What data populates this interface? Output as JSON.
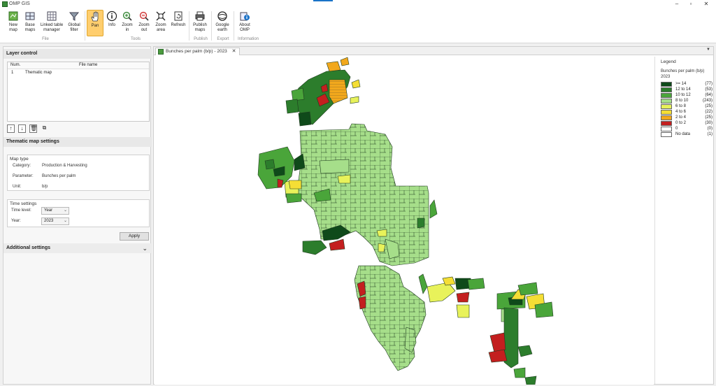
{
  "window": {
    "title": "OMP GIS",
    "controls": [
      "–",
      "▫",
      "✕"
    ]
  },
  "ribbon": {
    "buttons": [
      {
        "key": "new_map",
        "line1": "New",
        "line2": "map",
        "icon": "new-map-icon"
      },
      {
        "key": "base_maps",
        "line1": "Base",
        "line2": "maps",
        "icon": "base-maps-icon"
      },
      {
        "key": "linked_table",
        "line1": "Linked table",
        "line2": "manager",
        "icon": "table-icon"
      },
      {
        "key": "global_filter",
        "line1": "Global",
        "line2": "filter",
        "icon": "filter-icon"
      },
      {
        "key": "pan",
        "line1": "Pan",
        "line2": "",
        "icon": "hand-icon"
      },
      {
        "key": "info",
        "line1": "Info",
        "line2": "",
        "icon": "info-icon"
      },
      {
        "key": "zoom_in",
        "line1": "Zoom",
        "line2": "in",
        "icon": "zoom-in-icon"
      },
      {
        "key": "zoom_out",
        "line1": "Zoom",
        "line2": "out",
        "icon": "zoom-out-icon"
      },
      {
        "key": "zoom_area",
        "line1": "Zoom",
        "line2": "area",
        "icon": "zoom-area-icon"
      },
      {
        "key": "refresh",
        "line1": "Refresh",
        "line2": "",
        "icon": "refresh-icon"
      },
      {
        "key": "publish_maps",
        "line1": "Publish",
        "line2": "maps",
        "icon": "printer-icon"
      },
      {
        "key": "google_earth",
        "line1": "Google",
        "line2": "earth",
        "icon": "google-earth-icon"
      },
      {
        "key": "about_omp",
        "line1": "About",
        "line2": "OMP",
        "icon": "about-icon"
      }
    ],
    "groups": [
      "File",
      "Tools",
      "Publish",
      "Export",
      "Information"
    ]
  },
  "left_panel": {
    "layer_control": {
      "title": "Layer control",
      "columns": [
        "Num.",
        "File name"
      ],
      "rows": [
        {
          "num": "1",
          "name": "Thematic map"
        }
      ]
    },
    "thematic_settings": {
      "title": "Thematic map settings",
      "map_type": {
        "caption": "Map type",
        "category_label": "Category:",
        "category_value": "Production & Harvesting",
        "parameter_label": "Parameter:",
        "parameter_value": "Bunches per palm",
        "unit_label": "Unit:",
        "unit_value": "b/p"
      },
      "time_settings": {
        "caption": "Time settings",
        "time_level_label": "Time level:",
        "time_level_value": "Year",
        "year_label": "Year:",
        "year_value": "2023"
      },
      "apply_label": "Apply"
    },
    "additional_settings": {
      "title": "Additional settings"
    }
  },
  "map_tab": {
    "label": "Bunches per palm (b/p) - 2023",
    "close": "✕"
  },
  "legend": {
    "title": "Legend",
    "subtitle": "Bunches per palm (b/p)",
    "year": "2023",
    "classes": [
      {
        "label": ">= 14",
        "count": "(77)",
        "color": "#0f4a1a"
      },
      {
        "label": "12 to 14",
        "count": "(53)",
        "color": "#2c7d2c"
      },
      {
        "label": "10 to 12",
        "count": "(64)",
        "color": "#4aa53a"
      },
      {
        "label": "8 to 10",
        "count": "(243)",
        "color": "#a6de8a"
      },
      {
        "label": "6 to 8",
        "count": "(25)",
        "color": "#e8f25a"
      },
      {
        "label": "4 to 6",
        "count": "(22)",
        "color": "#f5de35"
      },
      {
        "label": "2 to 4",
        "count": "(25)",
        "color": "#f2a81c"
      },
      {
        "label": "0 to 2",
        "count": "(30)",
        "color": "#c31f1f"
      },
      {
        "label": "0",
        "count": "(0)",
        "color": "#ffffff"
      },
      {
        "label": "No data",
        "count": "(1)",
        "color": "#ffffff"
      }
    ]
  }
}
